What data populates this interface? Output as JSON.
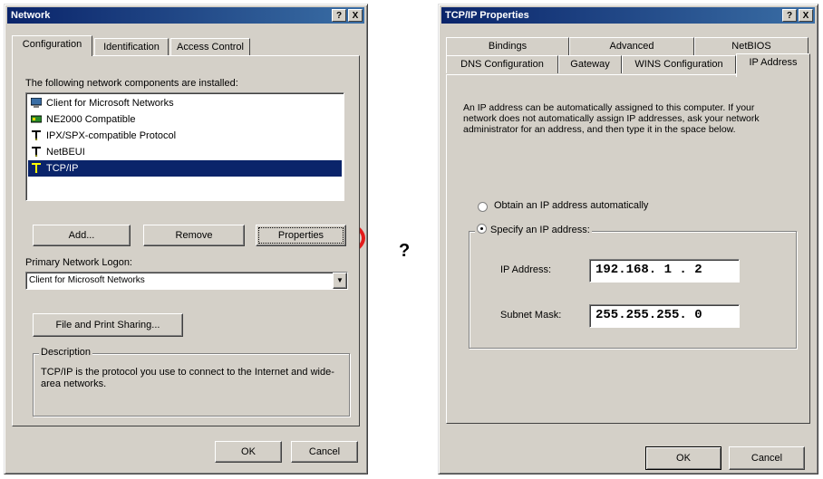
{
  "network": {
    "title": "Network",
    "tabs": [
      "Configuration",
      "Identification",
      "Access Control"
    ],
    "installed_label": "The following network components are installed:",
    "components": [
      {
        "label": "Client for Microsoft Networks",
        "icon": "client-icon"
      },
      {
        "label": "NE2000 Compatible",
        "icon": "network-card-icon"
      },
      {
        "label": "IPX/SPX-compatible Protocol",
        "icon": "protocol-icon"
      },
      {
        "label": "NetBEUI",
        "icon": "protocol-icon"
      },
      {
        "label": "TCP/IP",
        "icon": "protocol-icon",
        "selected": true
      }
    ],
    "add_label": "Add...",
    "remove_label": "Remove",
    "properties_label": "Properties",
    "logon_label": "Primary Network Logon:",
    "logon_value": "Client for Microsoft Networks",
    "file_print_label": "File and Print Sharing...",
    "description_legend": "Description",
    "description_text": "TCP/IP is the protocol you use to connect to the Internet and wide-area networks.",
    "ok_label": "OK",
    "cancel_label": "Cancel",
    "help_btn": "?",
    "close_btn": "X",
    "highlight_color": "#e31b1b"
  },
  "arrow_text": "?",
  "tcpip": {
    "title": "TCP/IP Properties",
    "tabs_row1": [
      "Bindings",
      "Advanced",
      "NetBIOS"
    ],
    "tabs_row2": [
      "DNS Configuration",
      "Gateway",
      "WINS Configuration",
      "IP Address"
    ],
    "info_text": "An IP address can be automatically assigned to this computer. If your network does not automatically assign IP addresses, ask your network administrator for an address, and then type it in the space below.",
    "obtain_label": "Obtain an IP address automatically",
    "specify_label": "Specify an IP address:",
    "ip_label": "IP Address:",
    "ip_value": "192.168. 1 . 2",
    "mask_label": "Subnet Mask:",
    "mask_value": "255.255.255. 0",
    "ok_label": "OK",
    "cancel_label": "Cancel",
    "help_btn": "?",
    "close_btn": "X"
  }
}
